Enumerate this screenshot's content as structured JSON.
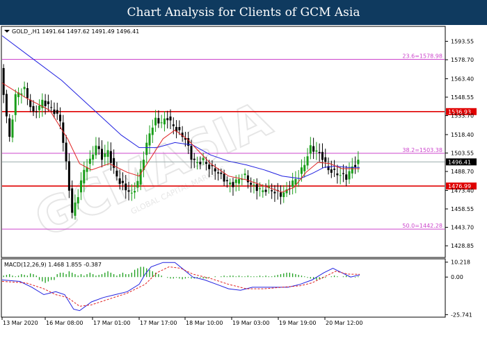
{
  "header": {
    "title": "Chart Analysis for Clients of GCM Asia"
  },
  "watermark": {
    "text": "GCMASIA",
    "subtext": "GLOBAL CAPITAL MARKETS"
  },
  "colors": {
    "title_bg": "#0f3a5f",
    "bull": "#1a9e1a",
    "bear": "#000000",
    "ma_fast": "#e02020",
    "ma_slow": "#2020e0",
    "fib": "#cc44cc",
    "sr": "#e00000",
    "macd_hist": "#1a9e1a",
    "macd_signal": "#e02020",
    "macd_line": "#2020e0"
  },
  "chart_data": [
    {
      "type": "candlestick",
      "symbol_info": "GOLD_,H1  1491.64 1497.62 1491.49 1496.41",
      "ylim": [
        1420,
        1605
      ],
      "y_ticks": [
        1593.55,
        1578.7,
        1563.4,
        1548.55,
        1533.7,
        1518.4,
        1503.55,
        1488.7,
        1473.4,
        1458.55,
        1443.7,
        1428.85
      ],
      "x_labels": [
        "13 Mar 2020",
        "16 Mar 08:00",
        "17 Mar 01:00",
        "17 Mar 17:00",
        "18 Mar 10:00",
        "19 Mar 03:00",
        "19 Mar 19:00",
        "20 Mar 12:00"
      ],
      "current_price": {
        "label": "1496.41",
        "value": 1496.41
      },
      "levels": [
        {
          "label": "23.6=1578.98",
          "value": 1578.98,
          "kind": "fib"
        },
        {
          "label": "38.2=1503.38",
          "value": 1503.38,
          "kind": "fib"
        },
        {
          "label": "50.0=1442.28",
          "value": 1442.28,
          "kind": "fib"
        },
        {
          "label": "1536.93",
          "value": 1536.93,
          "kind": "sr"
        },
        {
          "label": "1476.99",
          "value": 1476.99,
          "kind": "sr"
        }
      ],
      "close_path": [
        [
          0,
          1570
        ],
        [
          3,
          1515
        ],
        [
          5,
          1550
        ],
        [
          8,
          1555
        ],
        [
          11,
          1535
        ],
        [
          14,
          1545
        ],
        [
          17,
          1540
        ],
        [
          20,
          1530
        ],
        [
          22,
          1495
        ],
        [
          24,
          1455
        ],
        [
          26,
          1470
        ],
        [
          28,
          1490
        ],
        [
          30,
          1497
        ],
        [
          32,
          1510
        ],
        [
          34,
          1500
        ],
        [
          36,
          1505
        ],
        [
          38,
          1490
        ],
        [
          40,
          1480
        ],
        [
          42,
          1475
        ],
        [
          44,
          1470
        ],
        [
          46,
          1480
        ],
        [
          48,
          1500
        ],
        [
          50,
          1520
        ],
        [
          52,
          1530
        ],
        [
          54,
          1528
        ],
        [
          56,
          1532
        ],
        [
          58,
          1525
        ],
        [
          60,
          1520
        ],
        [
          62,
          1515
        ],
        [
          64,
          1500
        ],
        [
          66,
          1495
        ],
        [
          68,
          1498
        ],
        [
          70,
          1492
        ],
        [
          72,
          1490
        ],
        [
          74,
          1485
        ],
        [
          76,
          1480
        ],
        [
          78,
          1478
        ],
        [
          80,
          1483
        ],
        [
          82,
          1485
        ],
        [
          84,
          1478
        ],
        [
          86,
          1475
        ],
        [
          88,
          1473
        ],
        [
          90,
          1475
        ],
        [
          92,
          1472
        ],
        [
          94,
          1470
        ],
        [
          96,
          1473
        ],
        [
          98,
          1480
        ],
        [
          100,
          1485
        ],
        [
          102,
          1495
        ],
        [
          104,
          1508
        ],
        [
          106,
          1505
        ],
        [
          108,
          1500
        ],
        [
          110,
          1490
        ],
        [
          112,
          1488
        ],
        [
          114,
          1486
        ],
        [
          116,
          1484
        ],
        [
          118,
          1492
        ],
        [
          120,
          1496.41
        ]
      ],
      "ma_fast_path": [
        [
          0,
          1560
        ],
        [
          8,
          1548
        ],
        [
          16,
          1538
        ],
        [
          22,
          1515
        ],
        [
          26,
          1495
        ],
        [
          30,
          1490
        ],
        [
          36,
          1495
        ],
        [
          42,
          1488
        ],
        [
          46,
          1485
        ],
        [
          50,
          1500
        ],
        [
          54,
          1515
        ],
        [
          58,
          1522
        ],
        [
          62,
          1515
        ],
        [
          66,
          1505
        ],
        [
          70,
          1495
        ],
        [
          76,
          1485
        ],
        [
          82,
          1482
        ],
        [
          88,
          1477
        ],
        [
          94,
          1472
        ],
        [
          98,
          1476
        ],
        [
          102,
          1488
        ],
        [
          106,
          1496
        ],
        [
          110,
          1495
        ],
        [
          114,
          1491
        ],
        [
          120,
          1491
        ]
      ],
      "ma_slow_path": [
        [
          0,
          1598
        ],
        [
          10,
          1580
        ],
        [
          20,
          1562
        ],
        [
          30,
          1540
        ],
        [
          40,
          1518
        ],
        [
          46,
          1508
        ],
        [
          52,
          1508
        ],
        [
          58,
          1512
        ],
        [
          64,
          1510
        ],
        [
          70,
          1502
        ],
        [
          76,
          1497
        ],
        [
          82,
          1494
        ],
        [
          88,
          1490
        ],
        [
          94,
          1485
        ],
        [
          100,
          1483
        ],
        [
          104,
          1487
        ],
        [
          108,
          1492
        ],
        [
          112,
          1493
        ],
        [
          116,
          1492
        ],
        [
          120,
          1492
        ]
      ]
    },
    {
      "type": "macd",
      "label": "MACD(12,26,9) 1.468 1.855 -0.387",
      "y_ticks": [
        10.218,
        0.0,
        -25.741
      ],
      "ylim": [
        -27,
        12
      ],
      "macd_path": [
        [
          0,
          -2
        ],
        [
          6,
          -3
        ],
        [
          10,
          -7
        ],
        [
          14,
          -12
        ],
        [
          18,
          -10
        ],
        [
          21,
          -12
        ],
        [
          24,
          -22
        ],
        [
          26,
          -23
        ],
        [
          30,
          -17
        ],
        [
          34,
          -14
        ],
        [
          38,
          -12
        ],
        [
          42,
          -10
        ],
        [
          46,
          -5
        ],
        [
          48,
          2
        ],
        [
          50,
          7
        ],
        [
          54,
          10
        ],
        [
          58,
          10
        ],
        [
          61,
          5
        ],
        [
          64,
          0
        ],
        [
          68,
          -2
        ],
        [
          72,
          -5
        ],
        [
          76,
          -8
        ],
        [
          80,
          -9
        ],
        [
          84,
          -7
        ],
        [
          88,
          -7
        ],
        [
          92,
          -7
        ],
        [
          96,
          -7
        ],
        [
          100,
          -5
        ],
        [
          104,
          -2
        ],
        [
          108,
          3
        ],
        [
          111,
          6
        ],
        [
          114,
          3
        ],
        [
          117,
          0
        ],
        [
          120,
          1.468
        ]
      ],
      "signal_path": [
        [
          0,
          -3
        ],
        [
          8,
          -4
        ],
        [
          14,
          -8
        ],
        [
          18,
          -12
        ],
        [
          22,
          -14
        ],
        [
          26,
          -20
        ],
        [
          30,
          -19
        ],
        [
          36,
          -15
        ],
        [
          42,
          -11
        ],
        [
          48,
          -5
        ],
        [
          52,
          3
        ],
        [
          56,
          7
        ],
        [
          60,
          6
        ],
        [
          64,
          2
        ],
        [
          70,
          -1
        ],
        [
          76,
          -5
        ],
        [
          82,
          -8
        ],
        [
          88,
          -8
        ],
        [
          94,
          -7
        ],
        [
          100,
          -6
        ],
        [
          104,
          -4
        ],
        [
          108,
          0
        ],
        [
          112,
          4
        ],
        [
          116,
          2
        ],
        [
          120,
          1.855
        ]
      ],
      "hist": [
        1,
        1.5,
        2,
        1,
        0.5,
        1,
        2,
        1.5,
        1,
        2.5,
        2,
        1,
        -2,
        -3,
        -4,
        -3,
        -2,
        -2,
        2,
        3,
        3,
        2,
        4,
        3,
        2,
        1,
        2,
        1,
        2,
        3,
        2,
        1,
        1.5,
        2,
        3,
        4,
        3,
        2,
        1,
        2,
        3,
        2,
        2,
        3,
        5,
        6,
        7,
        7,
        6,
        5,
        4,
        3,
        2,
        1,
        0,
        -0.5,
        -1,
        -1,
        -0.5,
        -1,
        -1.5,
        -1,
        -0.5,
        -1,
        -1,
        -0.5,
        -0.5,
        -1,
        -1,
        -0.5,
        0,
        0.5,
        0,
        0.5,
        1,
        0.5,
        1,
        1,
        0.5,
        1,
        0.5,
        0.5,
        1,
        0.5,
        0.5,
        0.5,
        1,
        0.5,
        1,
        0.5,
        0.5,
        1,
        1.5,
        2,
        2.5,
        3,
        3,
        2.5,
        2,
        1.5,
        1,
        0.5,
        -0.5,
        -1,
        -1.5,
        -2,
        -1.5,
        -1,
        -0.5,
        0,
        0.5,
        1,
        0.5,
        0,
        0.5,
        1,
        0.5,
        0,
        -0.387,
        0.5
      ]
    }
  ]
}
